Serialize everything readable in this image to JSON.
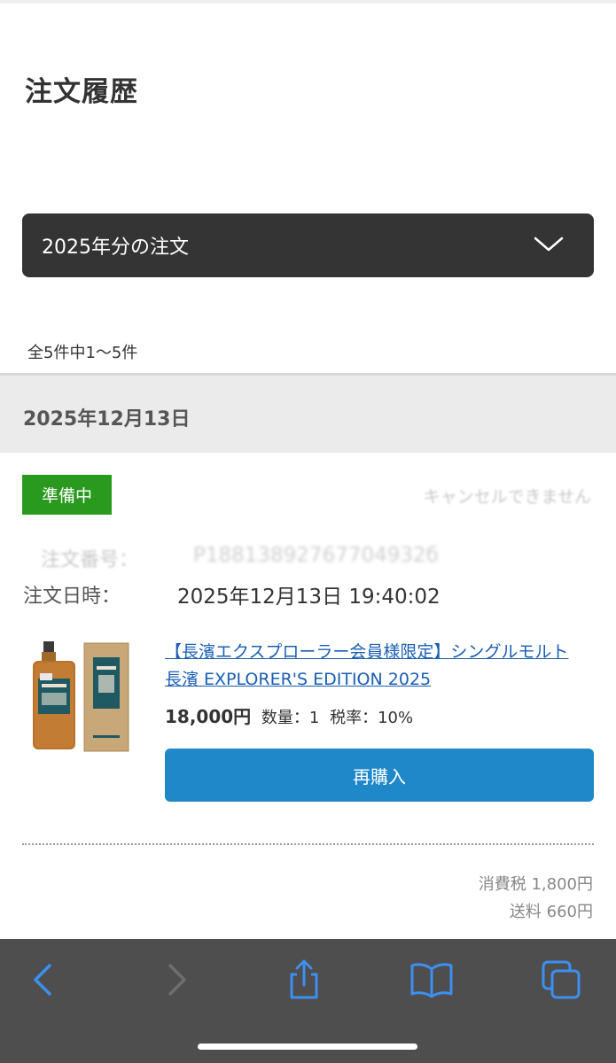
{
  "header": {
    "title": "注文履歴"
  },
  "filter": {
    "selected": "2025年分の注文",
    "icon": "chevron-down-icon"
  },
  "results": {
    "count_text": "全5件中1〜5件"
  },
  "order": {
    "date_heading": "2025年12月13日",
    "status": "準備中",
    "cancel_note": "キャンセルできません",
    "number_label": "注文番号：",
    "number_value": "P18813892767704932б",
    "datetime_label": "注文日時：",
    "datetime_value": "2025年12月13日 19:40:02",
    "item": {
      "name_line1": "【長濱エクスプローラー会員様限定】シングルモルト",
      "name_line2": "長濱 EXPLORER'S EDITION 2025",
      "price": "18,000円",
      "quantity": "数量：1",
      "tax_rate": "税率：10%",
      "rebuy_label": "再購入"
    },
    "summary": {
      "tax": "消費税 1,800円",
      "shipping": "送料 660円"
    }
  },
  "toolbar": {
    "icons": [
      "back-icon",
      "forward-icon",
      "share-icon",
      "bookmarks-icon",
      "tabs-icon"
    ],
    "accent": "#3d8ff0",
    "disabled": "#6e6e6e"
  },
  "colors": {
    "status_green": "#2a9a1f",
    "button_blue": "#1e88c9",
    "link_blue": "#1a5fb4",
    "select_dark": "#343434"
  }
}
